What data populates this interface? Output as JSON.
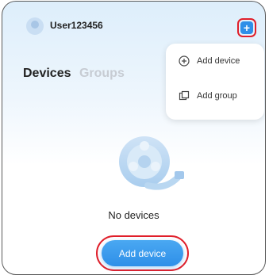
{
  "header": {
    "username": "User123456"
  },
  "tabs": [
    {
      "label": "Devices",
      "active": true
    },
    {
      "label": "Groups",
      "active": false
    }
  ],
  "menu": {
    "items": [
      {
        "label": "Add device",
        "icon": "plus-circle-icon"
      },
      {
        "label": "Add group",
        "icon": "add-group-icon"
      }
    ]
  },
  "empty": {
    "text": "No devices",
    "button_label": "Add device"
  },
  "colors": {
    "accent": "#2e8fe8",
    "highlight": "#e01f2a"
  }
}
